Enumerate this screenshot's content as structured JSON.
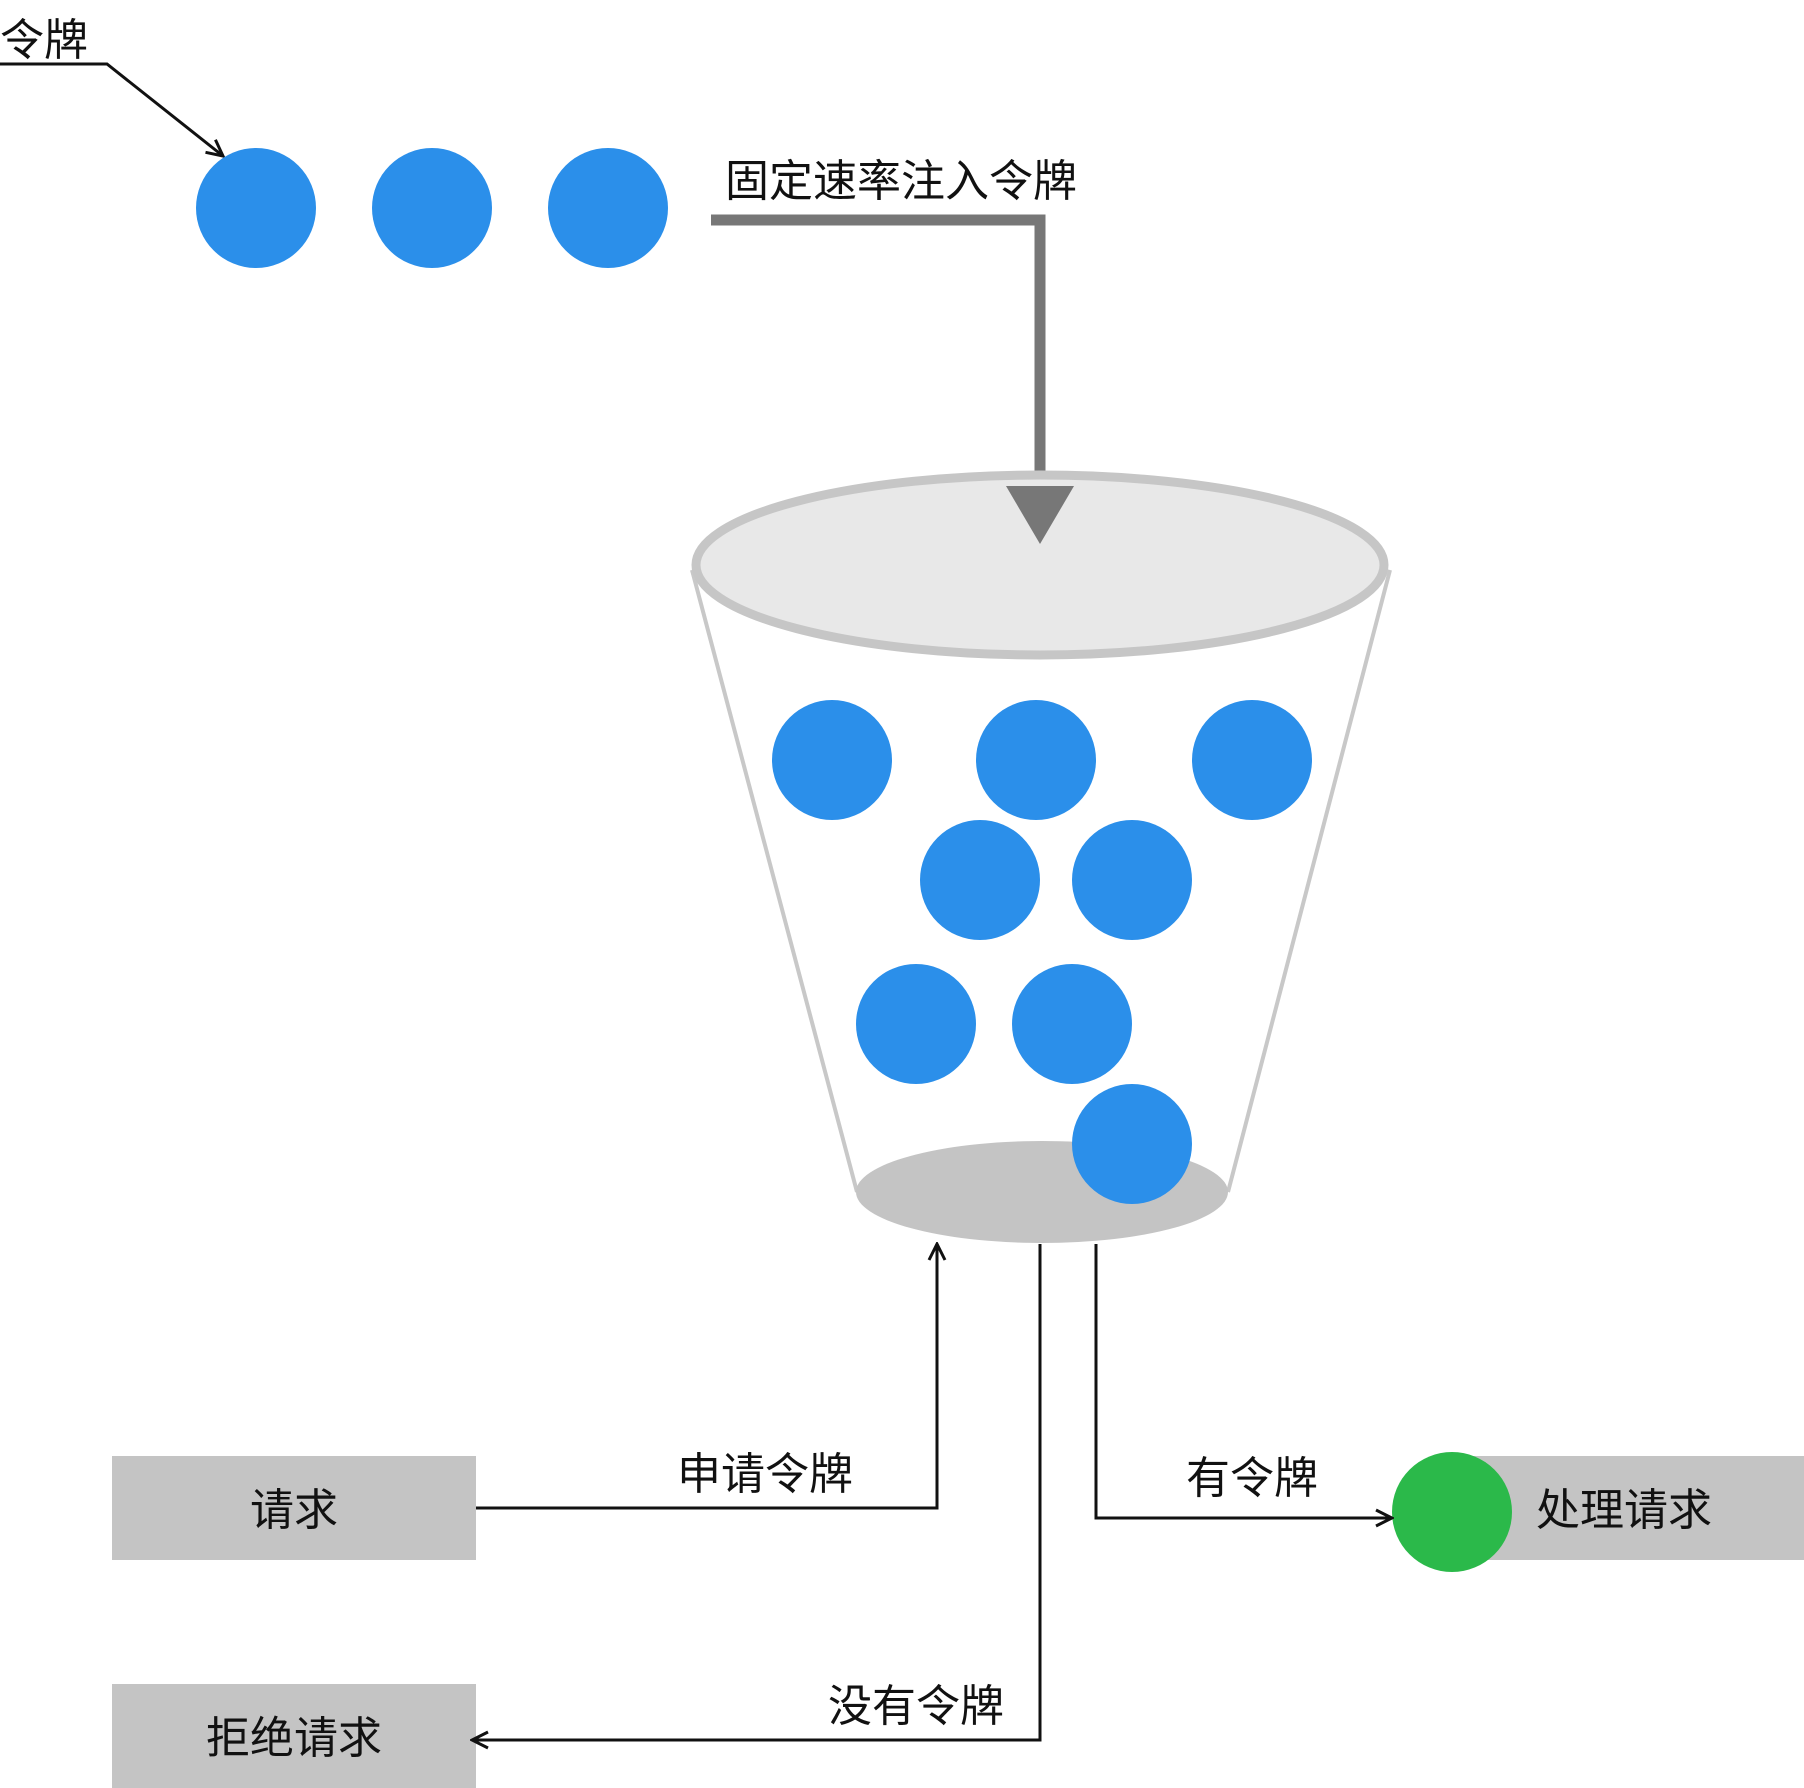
{
  "labels": {
    "token": "令牌",
    "fixed_rate": "固定速率注入令牌",
    "apply_token": "申请令牌",
    "has_token": "有令牌",
    "no_token": "没有令牌"
  },
  "boxes": {
    "request": "请求",
    "reject": "拒绝请求",
    "process": "处理请求"
  },
  "colors": {
    "token": "#2b8fea",
    "process_token": "#2bb94a",
    "box": "#c4c4c4",
    "bucket_rim": "#c6c6c6",
    "bucket_top": "#e8e8e8",
    "bucket_bottom": "#c4c4c4",
    "rate_arrow": "#777777",
    "line": "#111111"
  },
  "counts": {
    "incoming_tokens": 3,
    "tokens_in_bucket": 8
  }
}
